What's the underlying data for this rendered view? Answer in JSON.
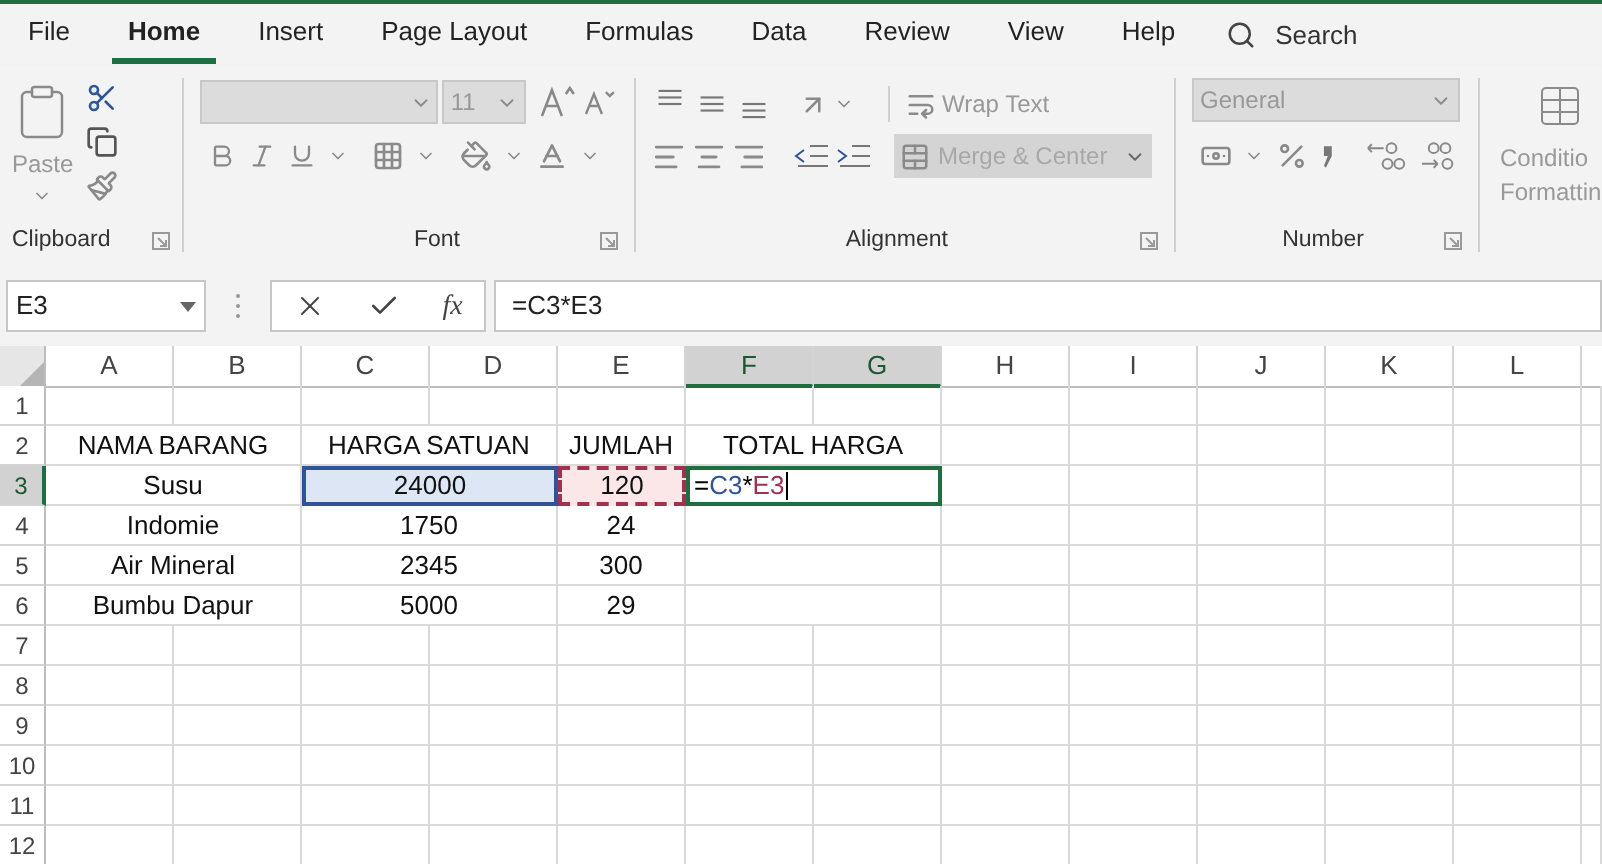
{
  "tabs": [
    {
      "label": "File",
      "selected": false
    },
    {
      "label": "Home",
      "selected": true
    },
    {
      "label": "Insert",
      "selected": false
    },
    {
      "label": "Page Layout",
      "selected": false
    },
    {
      "label": "Formulas",
      "selected": false
    },
    {
      "label": "Data",
      "selected": false
    },
    {
      "label": "Review",
      "selected": false
    },
    {
      "label": "View",
      "selected": false
    },
    {
      "label": "Help",
      "selected": false
    }
  ],
  "search_label": "Search",
  "ribbon": {
    "clipboard": {
      "paste": "Paste",
      "label": "Clipboard"
    },
    "font": {
      "size": "11",
      "label": "Font"
    },
    "alignment": {
      "wrap_text": "Wrap Text",
      "merge": "Merge & Center",
      "label": "Alignment"
    },
    "number": {
      "format": "General",
      "label": "Number"
    },
    "styles": {
      "line_1": "Conditio",
      "line_2": "Formattin"
    }
  },
  "formula_bar": {
    "name_box": "E3",
    "fx": "fx",
    "formula": "=C3*E3"
  },
  "columns": [
    {
      "label": "A",
      "selected": false
    },
    {
      "label": "B",
      "selected": false
    },
    {
      "label": "C",
      "selected": false
    },
    {
      "label": "D",
      "selected": false
    },
    {
      "label": "E",
      "selected": false
    },
    {
      "label": "F",
      "selected": true
    },
    {
      "label": "G",
      "selected": true
    },
    {
      "label": "H",
      "selected": false
    },
    {
      "label": "I",
      "selected": false
    },
    {
      "label": "J",
      "selected": false
    },
    {
      "label": "K",
      "selected": false
    },
    {
      "label": "L",
      "selected": false
    }
  ],
  "rows": [
    {
      "number": "1",
      "selected": false
    },
    {
      "number": "2",
      "selected": false,
      "item": "NAMA BARANG",
      "price": "HARGA SATUAN",
      "qty": "JUMLAH",
      "total": "TOTAL HARGA"
    },
    {
      "number": "3",
      "selected": true,
      "item": "Susu",
      "price": "24000",
      "qty": "120",
      "price_referenced": true,
      "qty_referenced": true,
      "total_parts": [
        {
          "text": "=",
          "color": "#000000"
        },
        {
          "text": "C3",
          "color": "#2f5597"
        },
        {
          "text": "*",
          "color": "#000000"
        },
        {
          "text": "E3",
          "color": "#a0314f"
        }
      ]
    },
    {
      "number": "4",
      "selected": false,
      "item": "Indomie",
      "price": "1750",
      "qty": "24"
    },
    {
      "number": "5",
      "selected": false,
      "item": "Air Mineral",
      "price": "2345",
      "qty": "300"
    },
    {
      "number": "6",
      "selected": false,
      "item": "Bumbu Dapur",
      "price": "5000",
      "qty": "29"
    },
    {
      "number": "7",
      "selected": false
    },
    {
      "number": "8",
      "selected": false
    },
    {
      "number": "9",
      "selected": false
    },
    {
      "number": "10",
      "selected": false
    },
    {
      "number": "11",
      "selected": false
    },
    {
      "number": "12",
      "selected": false
    }
  ]
}
